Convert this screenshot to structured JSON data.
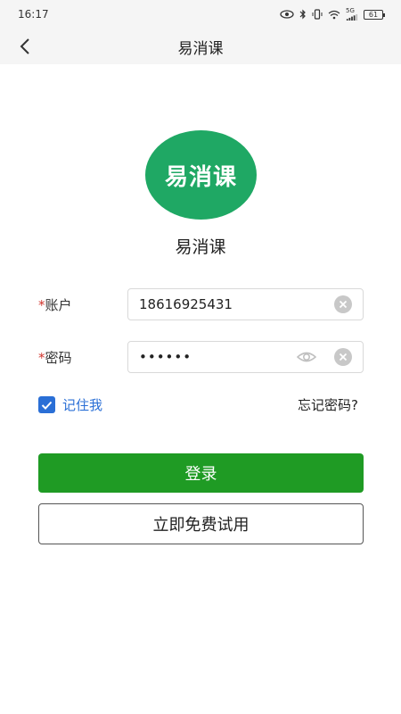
{
  "status_bar": {
    "time": "16:17",
    "network": "5G",
    "battery": "61",
    "icons": [
      "eye-icon",
      "bluetooth-icon",
      "vibrate-icon",
      "wifi-icon",
      "signal-icon",
      "battery-icon"
    ]
  },
  "app_bar": {
    "title": "易消课",
    "back_icon": "chevron-left-icon"
  },
  "logo": {
    "text": "易消课",
    "color": "#1fa864"
  },
  "app_name": "易消课",
  "form": {
    "account": {
      "required": "*",
      "label": "账户",
      "value": "18616925431"
    },
    "password": {
      "required": "*",
      "label": "密码",
      "value": "••••••"
    },
    "remember_me": "记住我",
    "forgot_password": "忘记密码?"
  },
  "buttons": {
    "login": "登录",
    "trial": "立即免费试用"
  },
  "colors": {
    "primary_green": "#1f9b24",
    "link_blue": "#2a6fd6",
    "required_red": "#d0342c"
  }
}
